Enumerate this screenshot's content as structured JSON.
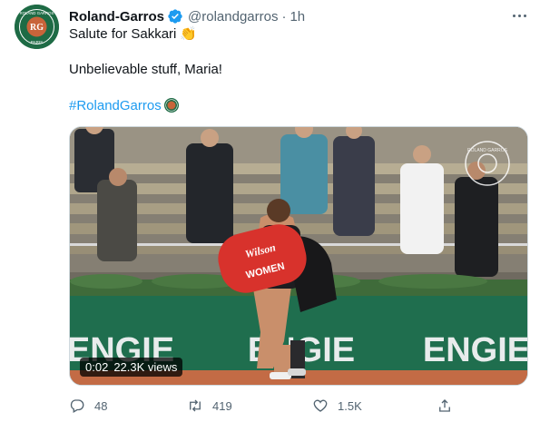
{
  "tweet": {
    "author_name": "Roland-Garros",
    "handle": "@rolandgarros",
    "separator": "·",
    "time": "1h",
    "lines": [
      "Salute for Sakkari",
      "Unbelievable stuff, Maria!",
      "#RolandGarros"
    ],
    "clap_emoji": "👏",
    "avatar_brand": "ROLAND GARROS",
    "avatar_sub": "PARIS",
    "avatar_monogram": "RG",
    "icons": {
      "verified": "verified-badge-icon",
      "more": "more-options-icon",
      "hashtag_emoji": "roland-garros-logo-emoji-icon"
    },
    "colors": {
      "brand_green": "#1e6b45",
      "clay": "#c8643a",
      "link_blue": "#1d9bf0",
      "muted": "#536471"
    }
  },
  "media": {
    "time": "0:02",
    "views": "22.3K views",
    "ad_text": "ENGIE",
    "watermark_brand": "ROLAND GARROS",
    "bag_brand": "Wilson",
    "bag_text": "WOMEN"
  },
  "actions": {
    "reply_count": "48",
    "retweet_count": "419",
    "like_count": "1.5K"
  }
}
